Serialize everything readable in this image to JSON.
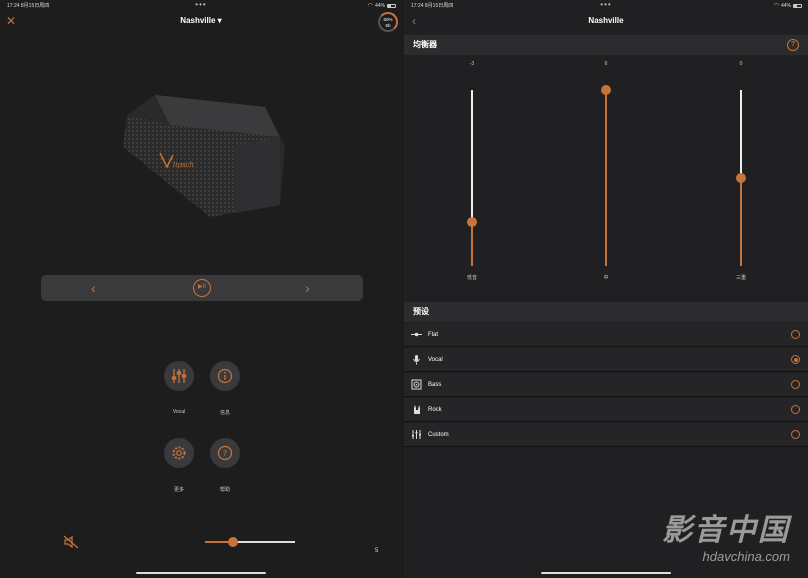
{
  "colors": {
    "accent": "#c8733a",
    "background": "#1d1d1e",
    "panel": "#3a3a3c"
  },
  "left": {
    "status": {
      "time": "17:24",
      "date": "8月15日周四",
      "dots": "•••",
      "battery_pct": "44%"
    },
    "title": "Nashville",
    "title_caret": "▾",
    "close_icon": "close-icon",
    "battery_ring": {
      "line1": "60%",
      "line2": "6h",
      "level": 0.6
    },
    "transport": {
      "prev": "‹",
      "next": "›",
      "play_label": "▶II"
    },
    "actions": [
      {
        "label": "Vocal",
        "icon": "equalizer-icon"
      },
      {
        "label": "信息",
        "icon": "info-icon"
      },
      {
        "label": "更多",
        "icon": "gear-icon"
      },
      {
        "label": "帮助",
        "icon": "help-icon"
      }
    ],
    "volume": {
      "value": 5,
      "level": 0.31,
      "display": "5"
    }
  },
  "right": {
    "status": {
      "time": "17:24",
      "date": "8月15日周四",
      "dots": "•••",
      "battery_pct": "44%"
    },
    "title": "Nashville",
    "back": "‹",
    "eq": {
      "header": "均衡器",
      "help": "?",
      "range": [
        -6,
        6
      ],
      "bands": [
        {
          "label": "低音",
          "value": -3,
          "display": "-3"
        },
        {
          "label": "中",
          "value": 6,
          "display": "6"
        },
        {
          "label": "三重",
          "value": 0,
          "display": "0"
        }
      ]
    },
    "presets": {
      "header": "预设",
      "items": [
        {
          "label": "Flat",
          "icon": "flat-line-icon",
          "selected": false
        },
        {
          "label": "Vocal",
          "icon": "microphone-icon",
          "selected": true
        },
        {
          "label": "Bass",
          "icon": "speaker-icon",
          "selected": false
        },
        {
          "label": "Rock",
          "icon": "rock-hand-icon",
          "selected": false
        },
        {
          "label": "Custom",
          "icon": "sliders-icon",
          "selected": false
        }
      ]
    }
  },
  "watermark": {
    "big": "影音中国",
    "small": "hdavchina.com"
  }
}
